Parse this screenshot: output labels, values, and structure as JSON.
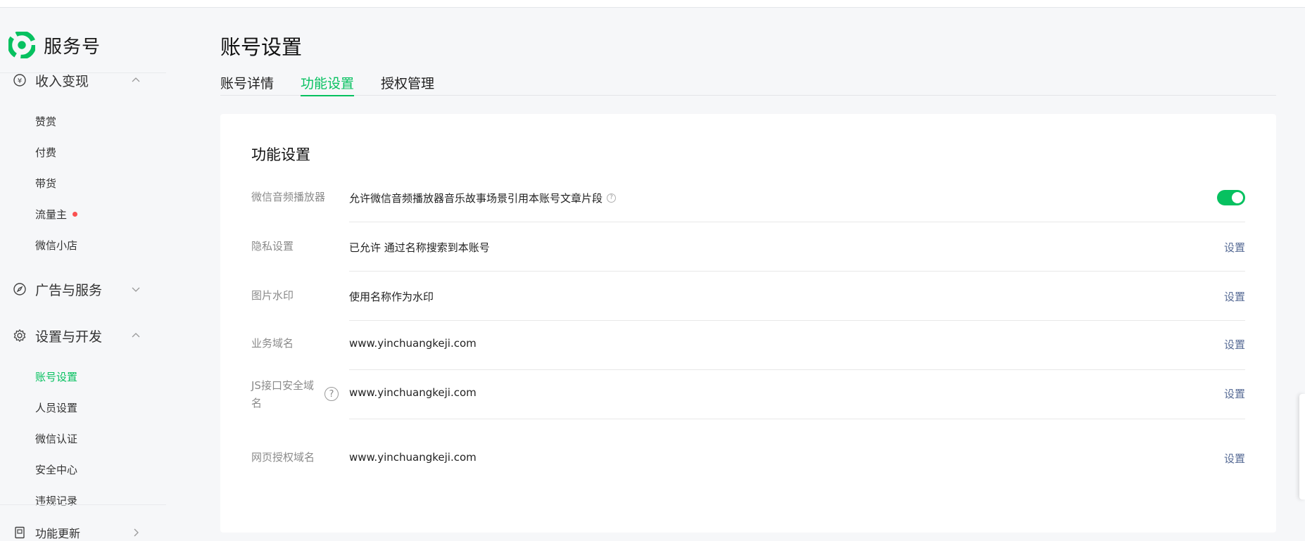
{
  "brand": {
    "name": "服务号"
  },
  "sidebar": {
    "groups": [
      {
        "label": "收入变现",
        "icon": "yen-circle-icon",
        "expanded": true
      },
      {
        "label": "广告与服务",
        "icon": "compass-icon",
        "expanded": false
      },
      {
        "label": "设置与开发",
        "icon": "gear-icon",
        "expanded": true
      },
      {
        "label": "功能更新",
        "icon": "notebook-icon",
        "expanded": false
      }
    ],
    "income_items": [
      "赞赏",
      "付费",
      "带货",
      "流量主",
      "微信小店"
    ],
    "settings_items": [
      "账号设置",
      "人员设置",
      "微信认证",
      "安全中心",
      "违规记录"
    ],
    "active_item": "账号设置"
  },
  "page": {
    "title": "账号设置",
    "tabs": [
      {
        "label": "账号详情",
        "active": false
      },
      {
        "label": "功能设置",
        "active": true
      },
      {
        "label": "授权管理",
        "active": false
      }
    ]
  },
  "card": {
    "title": "功能设置",
    "rows": [
      {
        "label": "微信音频播放器",
        "value": "允许微信音频播放器音乐故事场景引用本账号文章片段",
        "control": "toggle",
        "toggle_on": true
      },
      {
        "label": "隐私设置",
        "value": "已允许 通过名称搜索到本账号",
        "action": "设置"
      },
      {
        "label": "图片水印",
        "value": "使用名称作为水印",
        "action": "设置"
      },
      {
        "label": "业务域名",
        "value": "www.yinchuangkeji.com",
        "action": "设置"
      },
      {
        "label": "JS接口安全域名",
        "value": "www.yinchuangkeji.com",
        "action": "设置"
      },
      {
        "label": "网页授权域名",
        "value": "www.yinchuangkeji.com",
        "action": "设置"
      }
    ]
  },
  "colors": {
    "accent": "#07c160",
    "link": "#576b95",
    "badge": "#fa5151"
  }
}
